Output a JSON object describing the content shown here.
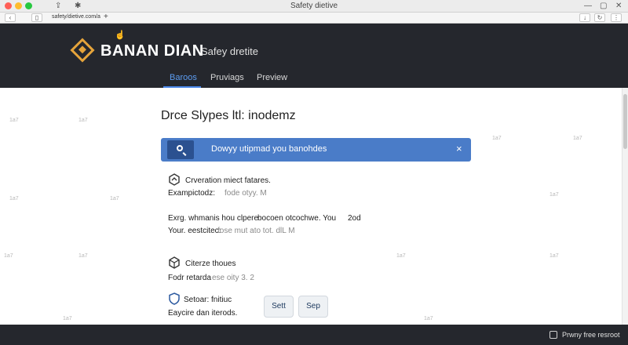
{
  "window": {
    "title": "Safety dietive",
    "tab_label": "safety/dietive.com/a",
    "new_tab": "+"
  },
  "hero": {
    "brand_name": "BANAN DIAN",
    "brand_tagline": "Safey dretite",
    "tabs": [
      {
        "label": "Baroos",
        "active": true
      },
      {
        "label": "Pruviags",
        "active": false
      },
      {
        "label": "Preview",
        "active": false
      }
    ]
  },
  "main": {
    "heading": "Drce Slypes ltl: inodemz",
    "alert": {
      "text": "Dowyy utipmad you banohdes",
      "close": "×"
    },
    "sections": [
      {
        "icon": "hexagon-icon",
        "title": "Crveration miect fatares.",
        "line1_label": "Exampictodz:",
        "line1_value": "fode otyy. M"
      },
      {
        "icon": null,
        "title": "Exrg. whmanis hou clpere",
        "title_suffix": "bocoen otcochwe. You",
        "note": "2od",
        "line1_label": "Your. eestcitec:",
        "line1_value": "fose mut ato tot. dlL M"
      },
      {
        "icon": "box-icon",
        "title": "Citerze thoues",
        "line1_label": "Fodr retarda",
        "line1_value": "ese oity 3. 2"
      },
      {
        "icon": "shield-icon",
        "title": "Setoar: fnitiuc",
        "line1_label": "Eaycire dan iterods.",
        "line1_value": ""
      }
    ],
    "buttons": {
      "set": "Sett",
      "sep": "Sep"
    }
  },
  "status": {
    "text": "Prwny free resroot"
  },
  "watermark": "1a7"
}
